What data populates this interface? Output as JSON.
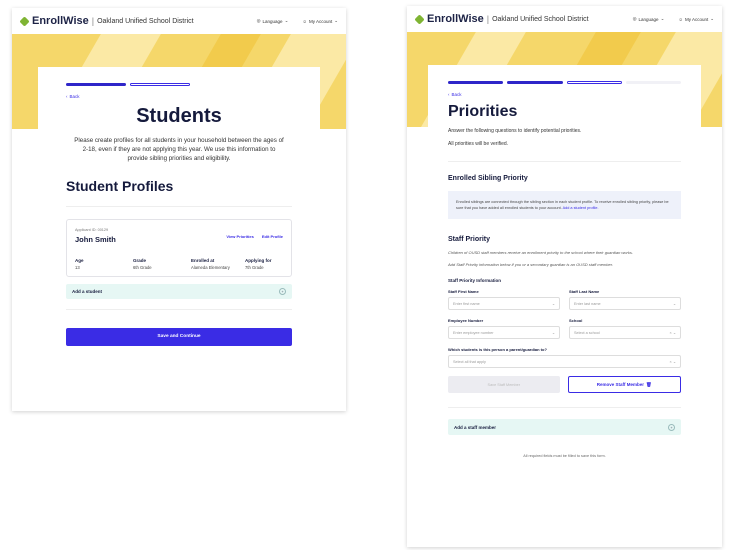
{
  "brand": {
    "name": "EnrollWise",
    "separator": "|",
    "district": "Oakland Unified School District"
  },
  "header": {
    "language": "Language",
    "language_caret": "⌄",
    "account": "My Account",
    "account_caret": "⌄"
  },
  "nav": {
    "back": "Back",
    "back_arrow": "‹"
  },
  "progress": {
    "left": {
      "current_step": 1,
      "total_steps": 2
    },
    "right": {
      "current_step": 2,
      "total_steps": 4
    }
  },
  "students_page": {
    "title": "Students",
    "intro": "Please create profiles for all students in your household between the ages of 2-18, even if they are not applying this year. We use this information to provide sibling priorities and eligibility.",
    "profiles_heading": "Student Profiles",
    "student": {
      "applicant_id": "Applicant ID: 00129",
      "name": "John Smith",
      "view_priorities": "View Priorities",
      "edit_profile": "Edit Profile",
      "fields": [
        {
          "label": "Age",
          "value": "13"
        },
        {
          "label": "Grade",
          "value": "6th Grade"
        },
        {
          "label": "Enrolled at",
          "value": "Alameda Elementary"
        },
        {
          "label": "Applying for",
          "value": "7th Grade"
        }
      ]
    },
    "add_student": "Add a student",
    "add_icon": "+",
    "save_continue": "Save and Continue"
  },
  "priorities_page": {
    "title": "Priorities",
    "intro": "Answer the following questions to identify potential priorities.",
    "verify_note": "All priorities will be verified.",
    "sibling": {
      "heading": "Enrolled Sibling Priority",
      "info": "Enrolled siblings are connected through the sibling section in each student profile. To receive enrolled sibling priority, please be sure that you have added all enrolled students to your account.",
      "link": "Add a student profile."
    },
    "staff": {
      "heading": "Staff Priority",
      "desc1": "Children of OUSD staff members receive an enrollment priority to the school where their guardian works.",
      "desc2": "Add Staff Priority information below if you or a secondary guardian is an OUSD staff member.",
      "info_heading": "Staff Priority Information",
      "first_name": {
        "label": "Staff First Name",
        "placeholder": "Enter first name"
      },
      "last_name": {
        "label": "Staff Last Name",
        "placeholder": "Enter last name"
      },
      "employee_number": {
        "label": "Employee Number",
        "placeholder": "Enter employee number"
      },
      "school": {
        "label": "School",
        "placeholder": "Select a school"
      },
      "students_question": {
        "label": "Which students is this person a parent/guardian to?",
        "placeholder": "Select all that apply"
      },
      "save_staff": "Save Staff Member",
      "remove_staff": "Remove Staff Member",
      "trash_icon": "🗑",
      "caret": "⌄",
      "clear_icon": "×"
    },
    "add_staff": "Add a staff member",
    "add_icon": "+",
    "footer_note": "All required fields must be filled to save this form."
  },
  "colors": {
    "primary": "#3a2ce5",
    "navy": "#151a3c",
    "banner": "#f5d76a",
    "mint": "#e6f7f4",
    "info": "#eef1fa",
    "logo": "#7fb433"
  }
}
